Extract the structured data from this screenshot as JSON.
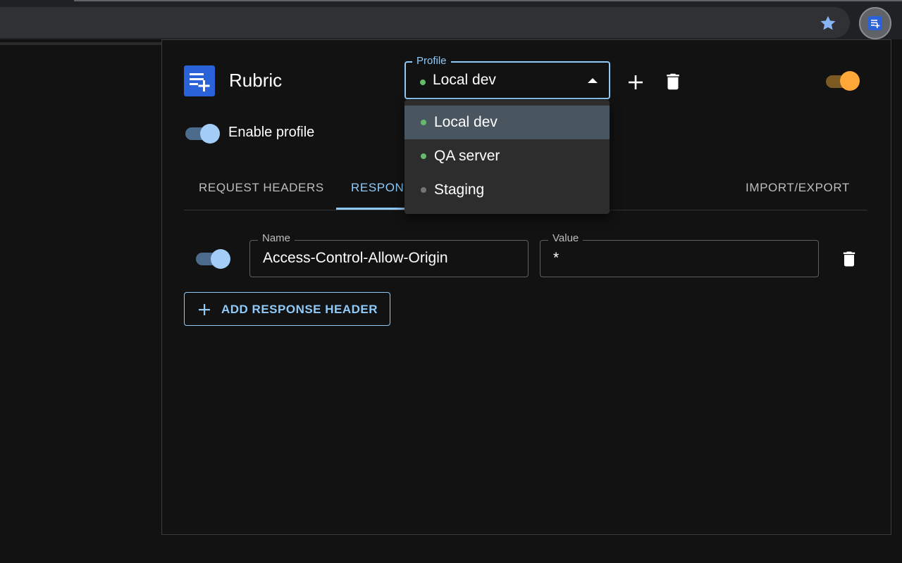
{
  "app": {
    "title": "Rubric"
  },
  "profile": {
    "legend": "Profile",
    "selected": "Local dev",
    "options": [
      {
        "label": "Local dev",
        "status_color": "#66bb6a"
      },
      {
        "label": "QA server",
        "status_color": "#66bb6a"
      },
      {
        "label": "Staging",
        "status_color": "#757575"
      }
    ]
  },
  "enable_profile": {
    "label": "Enable profile",
    "enabled": true
  },
  "tabs": [
    {
      "label": "Request Headers"
    },
    {
      "label": "Respon"
    },
    {
      "label": "Import/Export"
    }
  ],
  "header_row": {
    "enabled": true,
    "name_label": "Name",
    "name_value": "Access-Control-Allow-Origin",
    "value_label": "Value",
    "value_value": "*"
  },
  "add_header_label": "ADD RESPONSE HEADER",
  "theme_toggle": {
    "on": true
  },
  "colors": {
    "accent": "#90caf9",
    "brand": "#2962d9",
    "theme_toggle": "#ffa737",
    "active_status": "#66bb6a",
    "inactive_status": "#757575"
  },
  "icons": [
    "star-icon",
    "rubric-extension-icon",
    "rubric-logo-icon",
    "caret-up-icon",
    "plus-icon",
    "trash-icon"
  ]
}
